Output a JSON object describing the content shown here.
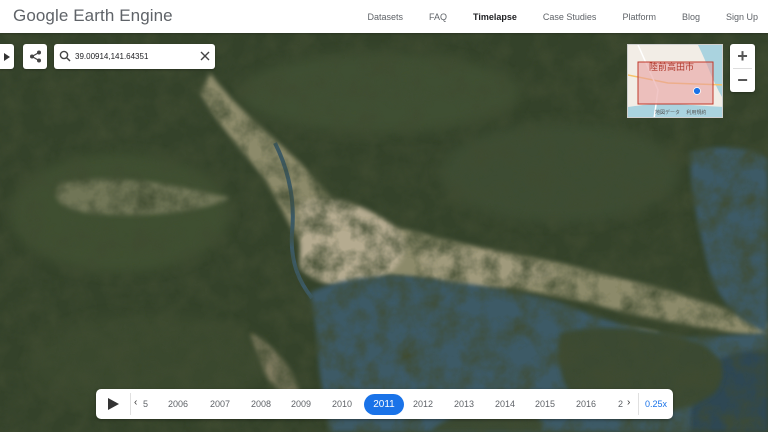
{
  "header": {
    "logo": "Google Earth Engine",
    "nav": [
      "Datasets",
      "FAQ",
      "Timelapse",
      "Case Studies",
      "Platform",
      "Blog",
      "Sign Up"
    ],
    "active_nav": "Timelapse"
  },
  "search": {
    "value": "39.00914,141.64351",
    "icon": "search-icon",
    "clear_icon": "close-icon"
  },
  "minimap": {
    "city_label": "陸前高田市",
    "attribution_1": "地図データ",
    "attribution_2": "利用規約"
  },
  "zoom": {
    "in_label": "+",
    "out_label": "−"
  },
  "timeline": {
    "prev_partial": "5",
    "years": [
      "2006",
      "2007",
      "2008",
      "2009",
      "2010",
      "2011",
      "2012",
      "2013",
      "2014",
      "2015",
      "2016"
    ],
    "next_partial": "2",
    "selected_year": "2011",
    "speed": "0.25x"
  },
  "colors": {
    "accent": "#1a73e8",
    "header_text": "#5f6368",
    "water": "#3b5a68",
    "forest": "#2f3d26",
    "urban": "#b9ae95"
  }
}
